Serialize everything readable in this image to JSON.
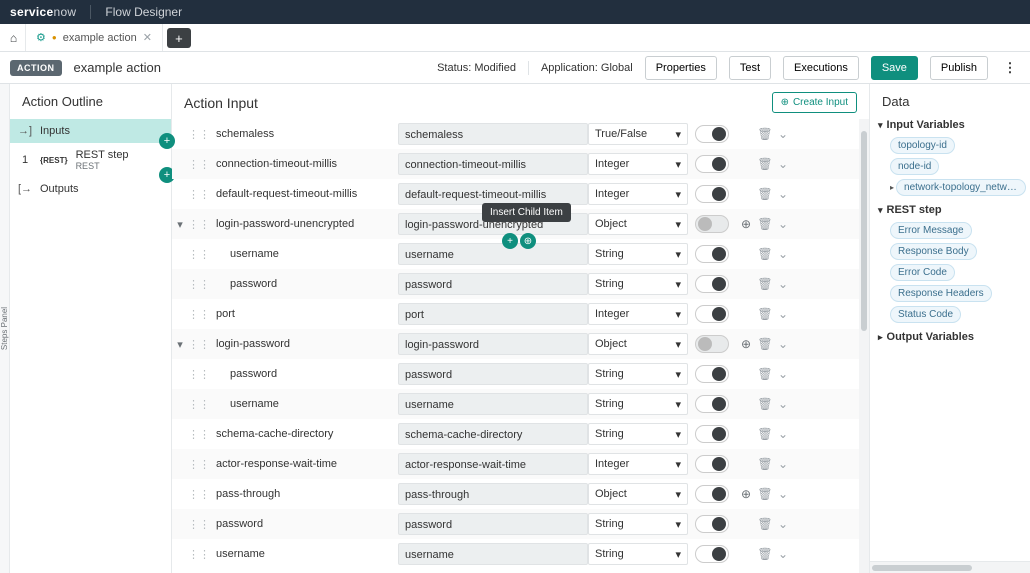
{
  "brand": {
    "logo_left": "service",
    "logo_right": "now",
    "product": "Flow Designer"
  },
  "tabs": {
    "home_icon": "⌂",
    "active_tab": {
      "glyph": "⚙",
      "dirty": "●",
      "title": "example action",
      "close": "✕"
    },
    "add": "+"
  },
  "header": {
    "pill": "ACTION",
    "title": "example action",
    "status_label": "Status:",
    "status_value": "Modified",
    "app_label": "Application:",
    "app_value": "Global",
    "buttons": {
      "properties": "Properties",
      "test": "Test",
      "executions": "Executions",
      "save": "Save",
      "publish": "Publish"
    },
    "kebab": "⋮"
  },
  "left": {
    "heading": "Action Outline",
    "rows": {
      "inputs": {
        "icon": "→]",
        "label": "Inputs"
      },
      "step1": {
        "num": "1",
        "tag": "{REST}",
        "title": "REST step",
        "sub": "REST"
      },
      "outputs": {
        "icon": "[→",
        "label": "Outputs"
      }
    }
  },
  "center": {
    "heading": "Action Input",
    "create": "Create Input",
    "tooltip": "Insert Child Item",
    "rows": [
      {
        "depth": 0,
        "name": "schemaless",
        "field": "schemaless",
        "type": "True/False",
        "toggle": "off"
      },
      {
        "depth": 0,
        "name": "connection-timeout-millis",
        "field": "connection-timeout-millis",
        "type": "Integer",
        "toggle": "off"
      },
      {
        "depth": 0,
        "name": "default-request-timeout-millis",
        "field": "default-request-timeout-millis",
        "type": "Integer",
        "toggle": "off"
      },
      {
        "depth": 0,
        "name": "login-password-unencrypted",
        "field": "login-password-unencrypted",
        "type": "Object",
        "toggle": "neutral",
        "expanded": true,
        "plus": true
      },
      {
        "depth": 1,
        "name": "username",
        "field": "username",
        "type": "String",
        "toggle": "off"
      },
      {
        "depth": 1,
        "name": "password",
        "field": "password",
        "type": "String",
        "toggle": "off"
      },
      {
        "depth": 0,
        "name": "port",
        "field": "port",
        "type": "Integer",
        "toggle": "off"
      },
      {
        "depth": 0,
        "name": "login-password",
        "field": "login-password",
        "type": "Object",
        "toggle": "neutral",
        "expanded": true,
        "plus": true
      },
      {
        "depth": 1,
        "name": "password",
        "field": "password",
        "type": "String",
        "toggle": "off"
      },
      {
        "depth": 1,
        "name": "username",
        "field": "username",
        "type": "String",
        "toggle": "off"
      },
      {
        "depth": 0,
        "name": "schema-cache-directory",
        "field": "schema-cache-directory",
        "type": "String",
        "toggle": "off"
      },
      {
        "depth": 0,
        "name": "actor-response-wait-time",
        "field": "actor-response-wait-time",
        "type": "Integer",
        "toggle": "off"
      },
      {
        "depth": 0,
        "name": "pass-through",
        "field": "pass-through",
        "type": "Object",
        "toggle": "off",
        "plus": true
      },
      {
        "depth": 0,
        "name": "password",
        "field": "password",
        "type": "String",
        "toggle": "off"
      },
      {
        "depth": 0,
        "name": "username",
        "field": "username",
        "type": "String",
        "toggle": "off"
      }
    ]
  },
  "right": {
    "heading": "Data",
    "sections": {
      "input_vars": "Input Variables",
      "rest_step": "REST step",
      "output_vars": "Output Variables"
    },
    "input_chips": [
      "topology-id",
      "node-id",
      "network-topology_network-topology…"
    ],
    "rest_chips": [
      "Error Message",
      "Response Body",
      "Error Code",
      "Response Headers",
      "Status Code"
    ]
  },
  "rail": {
    "label": "Steps Panel"
  }
}
